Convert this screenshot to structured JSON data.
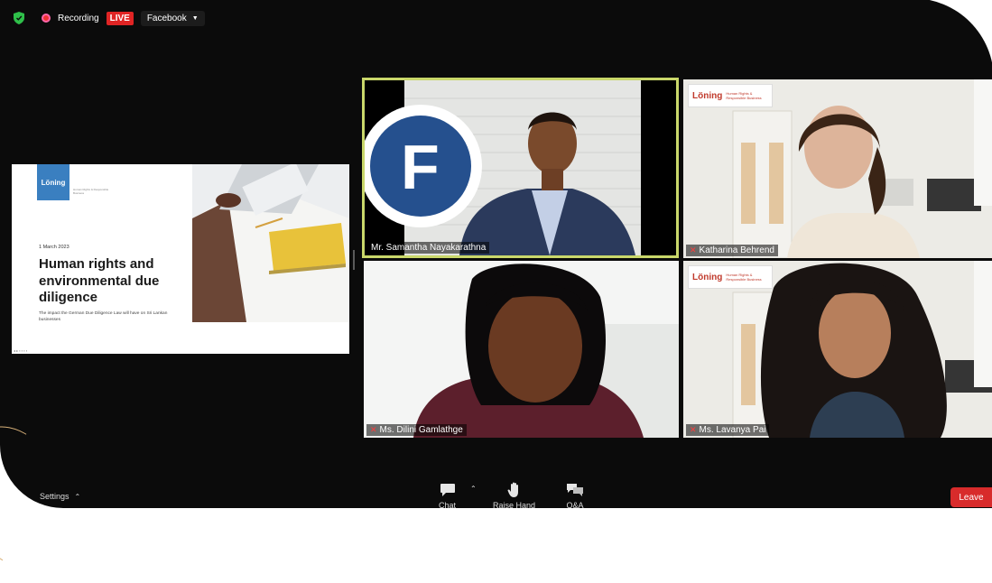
{
  "topbar": {
    "recording_label": "Recording",
    "live_badge": "LIVE",
    "stream_target": "Facebook"
  },
  "slide": {
    "logo_text": "Löning",
    "logo_subtitle": "Human Rights & Responsible Business",
    "date": "1 March 2023",
    "title": "Human rights and environmental due diligence",
    "description": "The impact the German Due Diligence Law will have on Sri Lankan businesses"
  },
  "participants": [
    {
      "name": "Mr. Samantha Nayakarathna",
      "muted": false,
      "active_speaker": true
    },
    {
      "name": "Katharina Behrend",
      "muted": true,
      "active_speaker": false
    },
    {
      "name": "Ms. Dilini Gamlathge",
      "muted": true,
      "active_speaker": false
    },
    {
      "name": "Ms. Lavanya Pai",
      "muted": true,
      "active_speaker": false
    }
  ],
  "background_sign": {
    "brand": "Löning",
    "tagline": "Human Rights & Responsible Business"
  },
  "bottombar": {
    "settings_label": "Settings",
    "chat_label": "Chat",
    "raise_hand_label": "Raise Hand",
    "qa_label": "Q&A",
    "leave_label": "Leave"
  },
  "colors": {
    "live_red": "#e02424",
    "active_speaker_border": "#c9d76a",
    "leave_red": "#d82b2b",
    "brand_blue": "#3a7fc0"
  }
}
